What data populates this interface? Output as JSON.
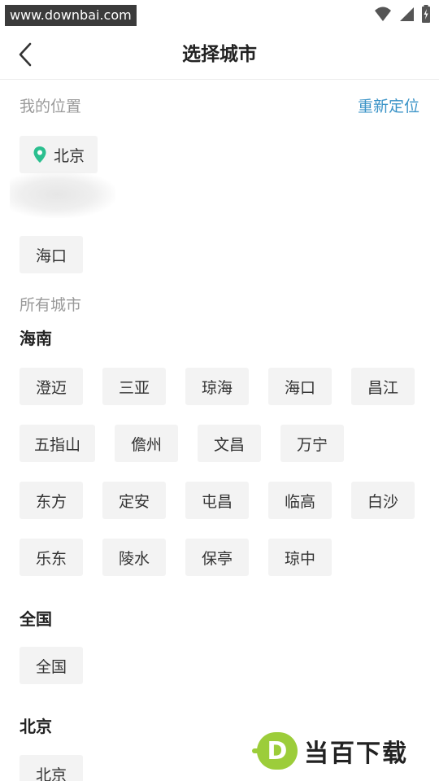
{
  "status_bar": {
    "watermark_url": "www.downbai.com",
    "icons": [
      "wifi-icon",
      "signal-icon",
      "battery-charging-icon"
    ]
  },
  "header": {
    "title": "选择城市",
    "back_icon": "chevron-left-icon"
  },
  "my_location": {
    "label": "我的位置",
    "relocate_label": "重新定位",
    "current_city": "北京",
    "pin_color": "#2bbf8f"
  },
  "recent": {
    "cities": [
      "海口"
    ]
  },
  "all_cities": {
    "label": "所有城市",
    "groups": [
      {
        "title": "海南",
        "rows": [
          [
            "澄迈",
            "三亚",
            "琼海",
            "海口",
            "昌江"
          ],
          [
            "五指山",
            "儋州",
            "文昌",
            "万宁"
          ],
          [
            "东方",
            "定安",
            "屯昌",
            "临高",
            "白沙"
          ],
          [
            "乐东",
            "陵水",
            "保亭",
            "琼中"
          ]
        ]
      },
      {
        "title": "全国",
        "rows": [
          [
            "全国"
          ]
        ]
      },
      {
        "title": "北京",
        "rows": [
          [
            "北京"
          ]
        ]
      }
    ]
  },
  "brand": {
    "logo_letter": "D",
    "logo_text": "当百下载",
    "logo_color": "#9ccd3a"
  },
  "colors": {
    "accent": "#3a93c7",
    "chip_bg": "#f3f3f3",
    "muted_text": "#9a9a9a"
  }
}
